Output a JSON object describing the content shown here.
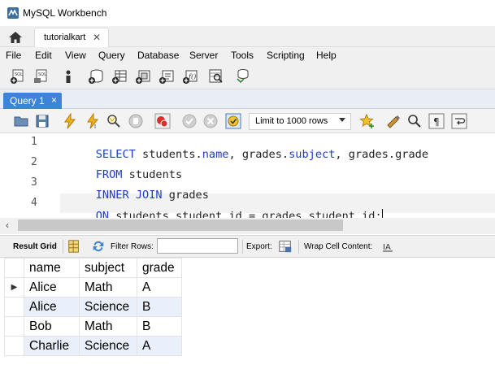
{
  "window": {
    "title": "MySQL Workbench"
  },
  "connection_tab": {
    "label": "tutorialkart",
    "close": "✕"
  },
  "menu": [
    "File",
    "Edit",
    "View",
    "Query",
    "Database",
    "Server",
    "Tools",
    "Scripting",
    "Help"
  ],
  "query_tab": {
    "label": "Query 1",
    "close": "×"
  },
  "sql_toolbar": {
    "limit_select": "Limit to 1000 rows"
  },
  "editor": {
    "line_numbers": [
      "1",
      "2",
      "3",
      "4"
    ],
    "lines": [
      [
        {
          "t": "SELECT",
          "kw": true
        },
        {
          "t": " students."
        },
        {
          "t": "name",
          "kw": true
        },
        {
          "t": ", grades."
        },
        {
          "t": "subject",
          "kw": true
        },
        {
          "t": ", grades.grade"
        }
      ],
      [
        {
          "t": "FROM",
          "kw": true
        },
        {
          "t": " students"
        }
      ],
      [
        {
          "t": "INNER",
          "kw": true
        },
        {
          "t": " "
        },
        {
          "t": "JOIN",
          "kw": true
        },
        {
          "t": " grades"
        }
      ],
      [
        {
          "t": "ON",
          "kw": true
        },
        {
          "t": " students.student_id = grades.student_id;"
        }
      ]
    ]
  },
  "result_toolbar": {
    "result_grid": "Result Grid",
    "filter_rows": "Filter Rows:",
    "filter_value": "",
    "export": "Export:",
    "wrap_cell": "Wrap Cell Content:"
  },
  "results": {
    "columns": [
      "name",
      "subject",
      "grade"
    ],
    "rows": [
      [
        "Alice",
        "Math",
        "A"
      ],
      [
        "Alice",
        "Science",
        "B"
      ],
      [
        "Bob",
        "Math",
        "B"
      ],
      [
        "Charlie",
        "Science",
        "A"
      ]
    ],
    "current_row_marker": "▶"
  },
  "colors": {
    "query_tab": "#3b84d8",
    "keyword": "#1d3cc9",
    "alt_row": "#e9f0fb"
  }
}
